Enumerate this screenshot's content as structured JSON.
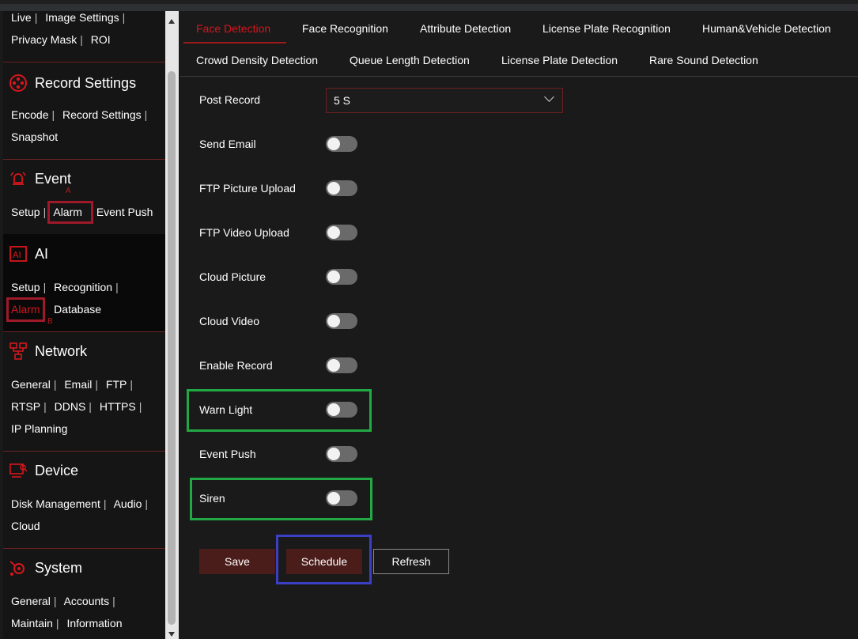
{
  "sidebar": {
    "top_links": [
      "Live",
      "Image Settings",
      "Privacy Mask",
      "ROI"
    ],
    "record": {
      "title": "Record Settings",
      "icon": "film-reel-icon",
      "links": [
        "Encode",
        "Record Settings",
        "Snapshot"
      ]
    },
    "event": {
      "title": "Event",
      "icon": "alarm-bell-icon",
      "links": [
        "Setup",
        "Alarm",
        "Event Push"
      ],
      "marker": "A"
    },
    "ai": {
      "title": "AI",
      "icon": "ai-chip-icon",
      "links": [
        "Setup",
        "Recognition",
        "Alarm",
        "Database"
      ],
      "marker": "B"
    },
    "network": {
      "title": "Network",
      "icon": "network-topology-icon",
      "links": [
        "General",
        "Email",
        "FTP",
        "RTSP",
        "DDNS",
        "HTTPS",
        "IP Planning"
      ]
    },
    "device": {
      "title": "Device",
      "icon": "device-monitor-icon",
      "links": [
        "Disk Management",
        "Audio",
        "Cloud"
      ]
    },
    "system": {
      "title": "System",
      "icon": "system-gear-icon",
      "links": [
        "General",
        "Accounts",
        "Maintain",
        "Information"
      ]
    }
  },
  "tabs": [
    "Face Detection",
    "Face Recognition",
    "Attribute Detection",
    "License Plate Recognition",
    "Human&Vehicle Detection",
    "Crowd Density Detection",
    "Queue Length Detection",
    "License Plate Detection",
    "Rare Sound Detection"
  ],
  "active_tab": "Face Detection",
  "form": {
    "post_record": {
      "label": "Post Record",
      "value": "5 S"
    },
    "toggles": [
      {
        "label": "Send Email",
        "on": false
      },
      {
        "label": "FTP Picture Upload",
        "on": false
      },
      {
        "label": "FTP Video Upload",
        "on": false
      },
      {
        "label": "Cloud Picture",
        "on": false
      },
      {
        "label": "Cloud Video",
        "on": false
      },
      {
        "label": "Enable Record",
        "on": false
      },
      {
        "label": "Warn Light",
        "on": false
      },
      {
        "label": "Event Push",
        "on": false
      },
      {
        "label": "Siren",
        "on": false
      }
    ]
  },
  "buttons": {
    "save": "Save",
    "schedule": "Schedule",
    "refresh": "Refresh"
  },
  "colors": {
    "accent_red": "#d6161c",
    "highlight_red": "#9e1a2a",
    "highlight_green": "#22a845",
    "highlight_blue": "#3b3fc4",
    "button_dark": "#4a1d1b"
  }
}
